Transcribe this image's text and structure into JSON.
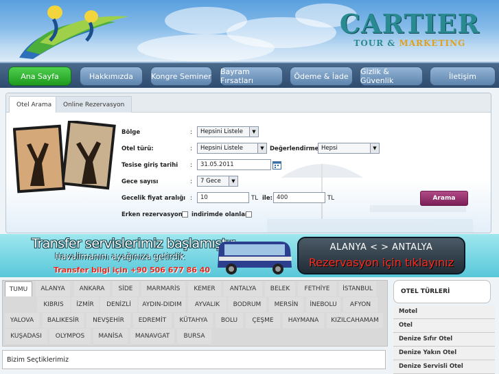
{
  "brand": {
    "name": "CARTIER",
    "sub_a": "TOUR &",
    "sub_b": "MARKETING"
  },
  "nav": [
    {
      "label": "Ana Sayfa",
      "active": true
    },
    {
      "label": "Hakkımızda"
    },
    {
      "label": "Kongre Seminer"
    },
    {
      "label": "Bayram Fırsatları"
    },
    {
      "label": "Ödeme & İade"
    },
    {
      "label": "Gizlik & Güvenlik"
    },
    {
      "label": "İletişim"
    }
  ],
  "search": {
    "tabs": [
      "Otel Arama",
      "Online Rezervasyon"
    ],
    "fields": {
      "region_label": "Bölge",
      "region_value": "Hepsini Listele",
      "type_label": "Otel türü:",
      "type_value": "Hepsini Listele",
      "rating_label": "Değerlendirme :",
      "rating_value": "Hepsi",
      "checkin_label": "Tesise giriş tarihi",
      "checkin_value": "31.05.2011",
      "nights_label": "Gece sayısı",
      "nights_value": "7 Gece",
      "price_label": "Gecelik fiyat aralığı",
      "price_min": "10",
      "price_currency_1": "TL",
      "price_to": "ile:",
      "price_max": "400",
      "price_currency_2": "TL",
      "early_label": "Erken rezervasyon :",
      "discount_label": "indirimde olanlar :",
      "colon": ":"
    },
    "button": "Arama"
  },
  "banner": {
    "line1": "Transfer servislerimiz başlamıştır.",
    "line2": "Havalimanını ayağınıza getirdik",
    "line3": "Transfer bilgi için +90 506 677 86 40",
    "cta_route": "ALANYA < > ANTALYA",
    "cta_action": "Rezervasyon için tıklayınız"
  },
  "cities": {
    "row1": [
      "TUMU",
      "ALANYA",
      "ANKARA",
      "SİDE",
      "MARMARİS",
      "KEMER",
      "ANTALYA",
      "BELEK",
      "FETHİYE",
      "İSTANBUL"
    ],
    "row2": [
      "KIBRIS",
      "İZMİR",
      "DENİZLİ",
      "AYDIN-DIDIM",
      "AYVALIK",
      "BODRUM",
      "MERSİN",
      "İNEBOLU",
      "AFYON"
    ],
    "row3": [
      "YALOVA",
      "BALIKESİR",
      "NEVŞEHİR",
      "EDREMİT",
      "KÜTAHYA",
      "BOLU",
      "ÇEŞME",
      "HAYMANA",
      "KIZILCAHAMAM"
    ],
    "row4": [
      "KUŞADASI",
      "OLYMPOS",
      "MANİSA",
      "MANAVGAT",
      "BURSA"
    ]
  },
  "picks_title": "Bizim Seçtiklerimiz",
  "sidebar": {
    "title": "OTEL TÜRLERİ",
    "items": [
      "Motel",
      "Otel",
      "Denize Sıfır Otel",
      "Denize Yakın Otel",
      "Denize Servisli Otel"
    ]
  }
}
